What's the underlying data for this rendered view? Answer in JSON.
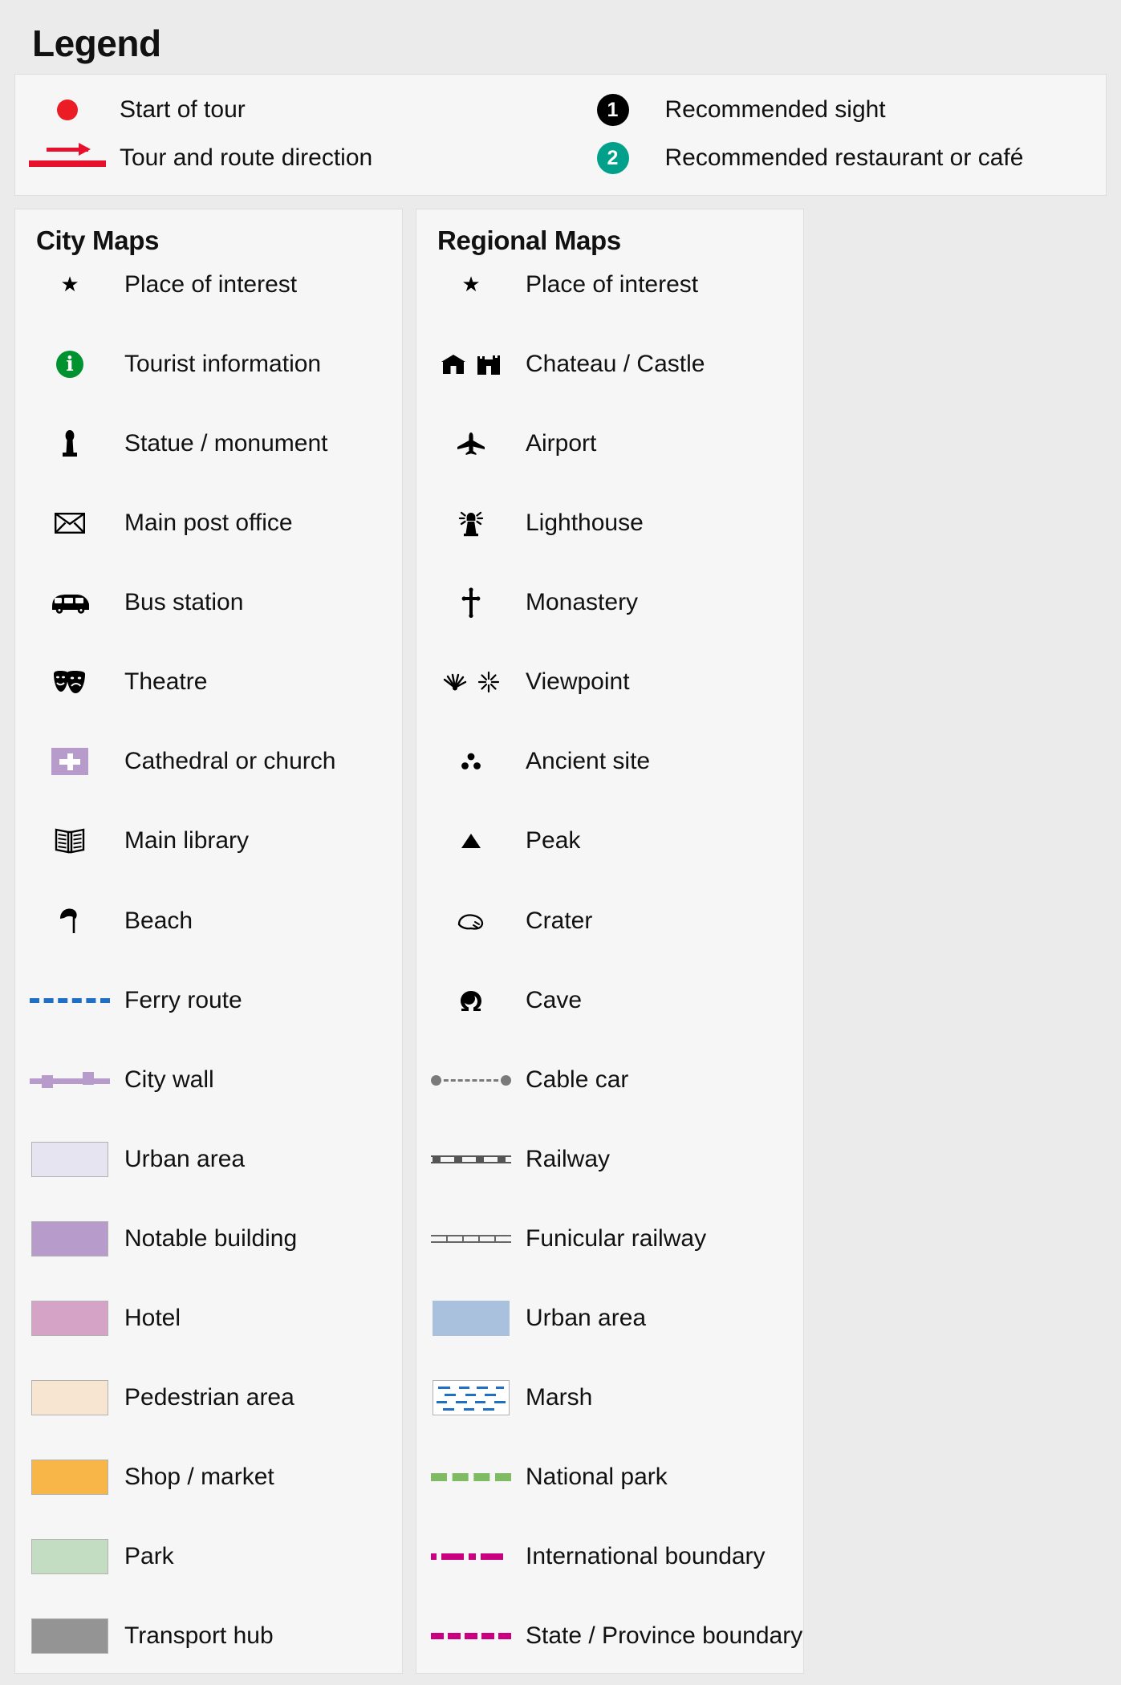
{
  "page": {
    "title": "Legend"
  },
  "tour": {
    "left_items": [
      {
        "icon": "red-dot-icon",
        "label": "Start of tour"
      },
      {
        "icon": "route-arrow-icon",
        "label": "Tour and route direction"
      }
    ],
    "right_items": [
      {
        "icon": "numbered-badge-black-icon",
        "badge": "1",
        "label": "Recommended sight",
        "color": "#000000"
      },
      {
        "icon": "numbered-badge-teal-icon",
        "badge": "2",
        "label": "Recommended restaurant or café",
        "color": "#00a08b"
      }
    ]
  },
  "city_maps": {
    "title": "City Maps",
    "items": [
      {
        "icon": "star-icon",
        "glyph": "★",
        "label": "Place of interest"
      },
      {
        "icon": "tourist-information-icon",
        "glyph": "i",
        "label": "Tourist information",
        "color": "#00922f"
      },
      {
        "icon": "statue-monument-icon",
        "glyph": "♟",
        "label": "Statue / monument"
      },
      {
        "icon": "envelope-icon",
        "glyph": "✉",
        "label": "Main post office"
      },
      {
        "icon": "bus-icon",
        "glyph": "🚌",
        "label": "Bus station"
      },
      {
        "icon": "theatre-masks-icon",
        "glyph": "🎭",
        "label": "Theatre"
      },
      {
        "icon": "cathedral-church-icon",
        "glyph": "✚",
        "label": "Cathedral or church",
        "color": "#b79ccb"
      },
      {
        "icon": "open-book-icon",
        "glyph": "📖",
        "label": "Main library"
      },
      {
        "icon": "beach-umbrella-icon",
        "glyph": "⛱",
        "label": "Beach"
      },
      {
        "icon": "ferry-route-line-icon",
        "label": "Ferry route",
        "color": "#1f6fc4"
      },
      {
        "icon": "city-wall-line-icon",
        "label": "City wall",
        "color": "#b79ccb"
      },
      {
        "icon": "urban-area-swatch",
        "label": "Urban area",
        "color": "#e7e4f2"
      },
      {
        "icon": "notable-building-swatch",
        "label": "Notable building",
        "color": "#b79ccb"
      },
      {
        "icon": "hotel-swatch",
        "label": "Hotel",
        "color": "#d5a3c6"
      },
      {
        "icon": "pedestrian-area-swatch",
        "label": "Pedestrian area",
        "color": "#f7e5d1"
      },
      {
        "icon": "shop-market-swatch",
        "label": "Shop / market",
        "color": "#f8b648"
      },
      {
        "icon": "park-swatch",
        "label": "Park",
        "color": "#c3ddc3"
      },
      {
        "icon": "transport-hub-swatch",
        "label": "Transport hub",
        "color": "#949494"
      }
    ]
  },
  "regional_maps": {
    "title": "Regional Maps",
    "items": [
      {
        "icon": "star-icon",
        "glyph": "★",
        "label": "Place of interest"
      },
      {
        "icon": "chateau-castle-icon",
        "label": "Chateau / Castle"
      },
      {
        "icon": "airport-plane-icon",
        "glyph": "✈",
        "label": "Airport"
      },
      {
        "icon": "lighthouse-icon",
        "label": "Lighthouse"
      },
      {
        "icon": "monastery-cross-icon",
        "glyph": "✝",
        "label": "Monastery"
      },
      {
        "icon": "viewpoint-icon",
        "label": "Viewpoint"
      },
      {
        "icon": "ancient-site-icon",
        "glyph": "∴",
        "label": "Ancient site"
      },
      {
        "icon": "peak-triangle-icon",
        "glyph": "▲",
        "label": "Peak"
      },
      {
        "icon": "crater-icon",
        "label": "Crater"
      },
      {
        "icon": "cave-icon",
        "label": "Cave"
      },
      {
        "icon": "cable-car-line-icon",
        "label": "Cable car",
        "color": "#7a7a7a"
      },
      {
        "icon": "railway-line-icon",
        "label": "Railway",
        "color": "#555555"
      },
      {
        "icon": "funicular-railway-line-icon",
        "label": "Funicular railway",
        "color": "#666666"
      },
      {
        "icon": "urban-area-swatch",
        "label": "Urban area",
        "color": "#a9c1dd"
      },
      {
        "icon": "marsh-swatch",
        "label": "Marsh",
        "color": "#1f6fc4"
      },
      {
        "icon": "national-park-line-icon",
        "label": "National park",
        "color": "#7fbb63"
      },
      {
        "icon": "international-boundary-line-icon",
        "label": "International boundary",
        "color": "#c9007f"
      },
      {
        "icon": "state-province-boundary-line-icon",
        "label": "State / Province boundary",
        "color": "#c9007f"
      }
    ]
  }
}
